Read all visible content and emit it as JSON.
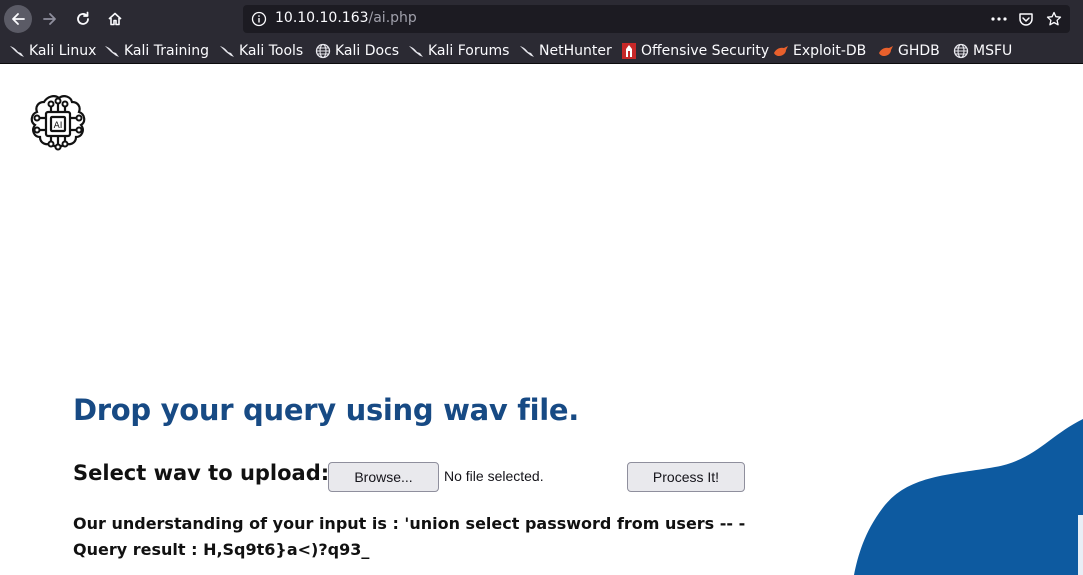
{
  "browser": {
    "url_host": "10.10.10.163",
    "url_path": "/ai.php",
    "bookmarks": [
      {
        "label": "Kali Linux",
        "icon": "kali-dragon-icon"
      },
      {
        "label": "Kali Training",
        "icon": "kali-dragon-icon"
      },
      {
        "label": "Kali Tools",
        "icon": "kali-dragon-icon"
      },
      {
        "label": "Kali Docs",
        "icon": "globe-icon"
      },
      {
        "label": "Kali Forums",
        "icon": "kali-dragon-icon"
      },
      {
        "label": "NetHunter",
        "icon": "kali-dragon-icon"
      },
      {
        "label": "Offensive Security",
        "icon": "offsec-icon"
      },
      {
        "label": "Exploit-DB",
        "icon": "exploitdb-icon"
      },
      {
        "label": "GHDB",
        "icon": "exploitdb-icon"
      },
      {
        "label": "MSFU",
        "icon": "globe-icon"
      }
    ]
  },
  "page": {
    "logo_text": "AI",
    "headline": "Drop your query using wav file.",
    "upload_label": "Select wav to upload:",
    "browse_label": "Browse...",
    "no_file_text": "No file selected.",
    "process_label": "Process It!",
    "understanding": "Our understanding of your input is : 'union select password from users -- -",
    "query_result": "Query result : H,Sq9t6}a<)?q93_"
  },
  "colors": {
    "headline": "#174a84",
    "wave": "#0d5aa0",
    "chrome": "#2b2a33"
  }
}
